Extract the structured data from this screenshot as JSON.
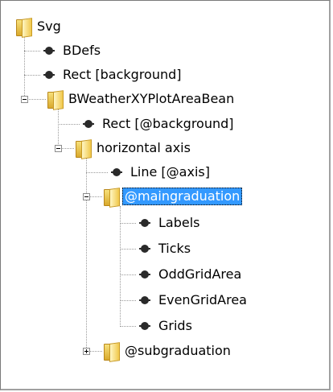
{
  "tree": {
    "nodes": [
      {
        "label": "Svg",
        "icon": "folder-icon"
      },
      {
        "label": "BDefs",
        "icon": "node-dot-icon"
      },
      {
        "label": "Rect [background]",
        "icon": "node-dot-icon"
      },
      {
        "label": "BWeatherXYPlotAreaBean",
        "icon": "folder-icon",
        "expander": "expanded"
      },
      {
        "label": "Rect [@background]",
        "icon": "node-dot-icon"
      },
      {
        "label": "horizontal axis",
        "icon": "folder-icon",
        "expander": "expanded"
      },
      {
        "label": "Line [@axis]",
        "icon": "node-dot-icon"
      },
      {
        "label": "@maingraduation",
        "icon": "folder-icon",
        "expander": "expanded",
        "selected": true
      },
      {
        "label": "Labels",
        "icon": "node-dot-icon"
      },
      {
        "label": "Ticks",
        "icon": "node-dot-icon"
      },
      {
        "label": "OddGridArea",
        "icon": "node-dot-icon"
      },
      {
        "label": "EvenGridArea",
        "icon": "node-dot-icon"
      },
      {
        "label": "Grids",
        "icon": "node-dot-icon"
      },
      {
        "label": "@subgraduation",
        "icon": "folder-icon",
        "expander": "collapsed"
      }
    ]
  },
  "colors": {
    "selection_bg": "#3399ff",
    "selection_text": "#ffffff",
    "folder": "#f0c84a",
    "connector": "#9a9a9a"
  }
}
